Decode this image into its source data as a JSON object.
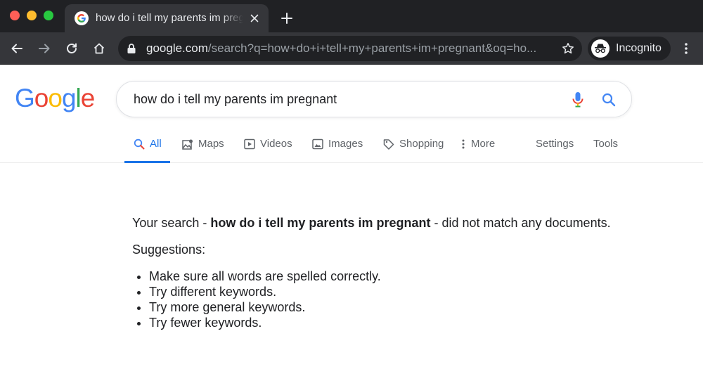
{
  "browser": {
    "tab": {
      "title": "how do i tell my parents im pregnant - Google Search"
    },
    "toolbar": {
      "url_domain": "google.com",
      "url_path": "/search?q=how+do+i+tell+my+parents+im+pregnant&oq=ho...",
      "profile_label": "Incognito"
    }
  },
  "search": {
    "query": "how do i tell my parents im pregnant"
  },
  "logo": {
    "letters": [
      "G",
      "o",
      "o",
      "g",
      "l",
      "e"
    ],
    "colors": [
      "#4285f4",
      "#ea4335",
      "#fbbc05",
      "#4285f4",
      "#34a853",
      "#ea4335"
    ]
  },
  "tabs": {
    "all": "All",
    "maps": "Maps",
    "videos": "Videos",
    "images": "Images",
    "shopping": "Shopping",
    "more": "More",
    "settings": "Settings",
    "tools": "Tools"
  },
  "result": {
    "prefix": "Your search - ",
    "query": "how do i tell my parents im pregnant",
    "suffix": " - did not match any documents.",
    "suggestions_title": "Suggestions:",
    "suggestions": [
      "Make sure all words are spelled correctly.",
      "Try different keywords.",
      "Try more general keywords.",
      "Try fewer keywords."
    ]
  },
  "colors": {
    "accent": "#1a73e8",
    "chrome_dark": "#202124",
    "chrome_mid": "#35363a"
  }
}
